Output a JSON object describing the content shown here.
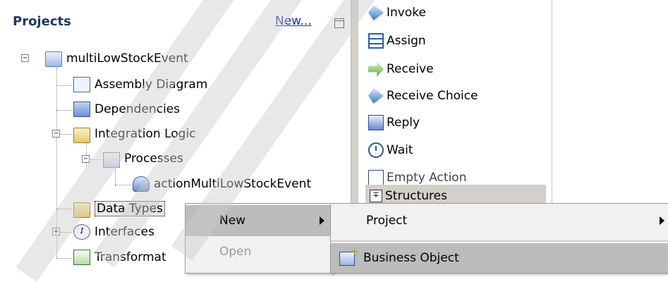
{
  "projects": {
    "title": "Projects",
    "new_link": "New...",
    "tree": {
      "root": "multiLowStockEvent",
      "assembly": "Assembly Diagram",
      "dependencies": "Dependencies",
      "integration": "Integration Logic",
      "processes": "Processes",
      "process_item": "actionMultiLowStockEvent",
      "data_types": "Data Types",
      "interfaces": "Interfaces",
      "transformations": "Transformat"
    }
  },
  "palette": {
    "invoke": "Invoke",
    "assign": "Assign",
    "receive": "Receive",
    "receive_choice": "Receive Choice",
    "reply": "Reply",
    "wait": "Wait",
    "empty_action": "Empty Action",
    "structures": "Structures"
  },
  "context_menu": {
    "new": "New",
    "open": "Open"
  },
  "submenu": {
    "project": "Project",
    "business_object": "Business Object"
  }
}
